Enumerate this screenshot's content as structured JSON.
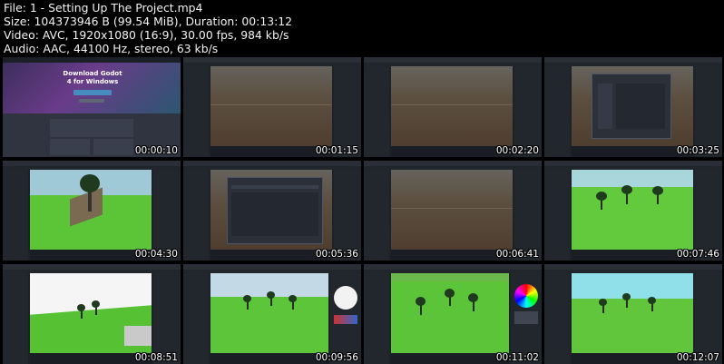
{
  "file_info": {
    "line1": "File: 1 - Setting Up The Project.mp4",
    "line2": "Size: 104373946 B (99.54 MiB), Duration: 00:13:12",
    "line3": "Video: AVC, 1920x1080 (16:9), 30.00 fps, 984 kb/s",
    "line4": "Audio: AAC, 44100 Hz, stereo, 63 kb/s"
  },
  "download_page": {
    "title": "Download Godot 4 for Windows"
  },
  "thumbnails": [
    {
      "time": "00:00:10",
      "scene": "website"
    },
    {
      "time": "00:01:15",
      "scene": "editor-empty"
    },
    {
      "time": "00:02:20",
      "scene": "editor-empty"
    },
    {
      "time": "00:03:25",
      "scene": "editor-dialog"
    },
    {
      "time": "00:04:30",
      "scene": "editor-tree-closeup"
    },
    {
      "time": "00:05:36",
      "scene": "editor-dialog-wide"
    },
    {
      "time": "00:06:41",
      "scene": "editor-empty"
    },
    {
      "time": "00:07:46",
      "scene": "editor-trees"
    },
    {
      "time": "00:08:51",
      "scene": "editor-white-sky"
    },
    {
      "time": "00:09:56",
      "scene": "editor-material"
    },
    {
      "time": "00:11:02",
      "scene": "editor-color-picker"
    },
    {
      "time": "00:12:07",
      "scene": "editor-final"
    }
  ],
  "colors": {
    "background": "#000000",
    "editor_panel": "#22272e",
    "grass": "#59c536",
    "dirt": "#5a4735",
    "sky": "#8fd9e6",
    "accent": "#478cbf"
  }
}
